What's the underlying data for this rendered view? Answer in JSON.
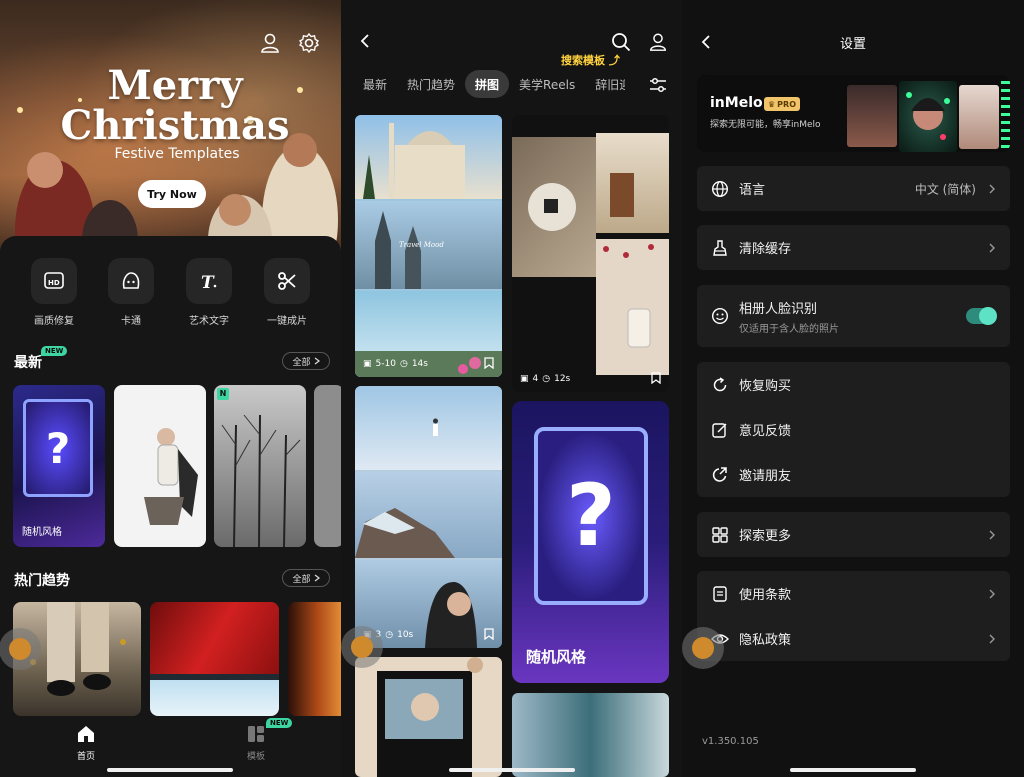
{
  "home": {
    "hero": {
      "title": "Merry Christmas",
      "subtitle": "Festive Templates",
      "button": "Try Now"
    },
    "tools": [
      {
        "label": "画质修复",
        "icon": "hd-icon"
      },
      {
        "label": "卡通",
        "icon": "cartoon-face-icon"
      },
      {
        "label": "艺术文字",
        "icon": "art-text-icon"
      },
      {
        "label": "一键成片",
        "icon": "scissors-icon"
      }
    ],
    "latest": {
      "title": "最新",
      "badge": "NEW",
      "all": "全部",
      "random_card": "随机风格",
      "n_badge": "N"
    },
    "trending": {
      "title": "热门趋势",
      "all": "全部"
    },
    "tabbar": {
      "home": "首页",
      "templates": "模板",
      "templates_badge": "NEW"
    }
  },
  "templates": {
    "search_hint": "搜索模板",
    "tabs": [
      "最新",
      "热门趋势",
      "拼图",
      "美学Reels",
      "辞旧迎"
    ],
    "active_tab": "拼图",
    "tiles": [
      {
        "count": "5-10",
        "duration": "14s"
      },
      {
        "count": "4",
        "duration": "12s"
      },
      {
        "count": "3",
        "duration": "10s"
      }
    ],
    "random_card": "随机风格",
    "travel_text": "Travel Mood"
  },
  "settings": {
    "title": "设置",
    "banner": {
      "brand": "inMelo",
      "pro": "PRO",
      "tagline": "探索无限可能，畅享inMelo"
    },
    "language": {
      "label": "语言",
      "value": "中文 (简体)"
    },
    "clear_cache": "清除缓存",
    "face_recognition": {
      "label": "相册人脸识别",
      "sub": "仅适用于含人脸的照片",
      "enabled": true
    },
    "restore": "恢复购买",
    "feedback": "意见反馈",
    "invite": "邀请朋友",
    "explore": "探索更多",
    "terms": "使用条款",
    "privacy": "隐私政策",
    "version": "v1.350.105"
  },
  "colors": {
    "accent_green": "#3dd6a3",
    "toggle": "#5ee2c6",
    "hint_yellow": "#ffd23f",
    "random_purple": "#5a2fb0"
  }
}
